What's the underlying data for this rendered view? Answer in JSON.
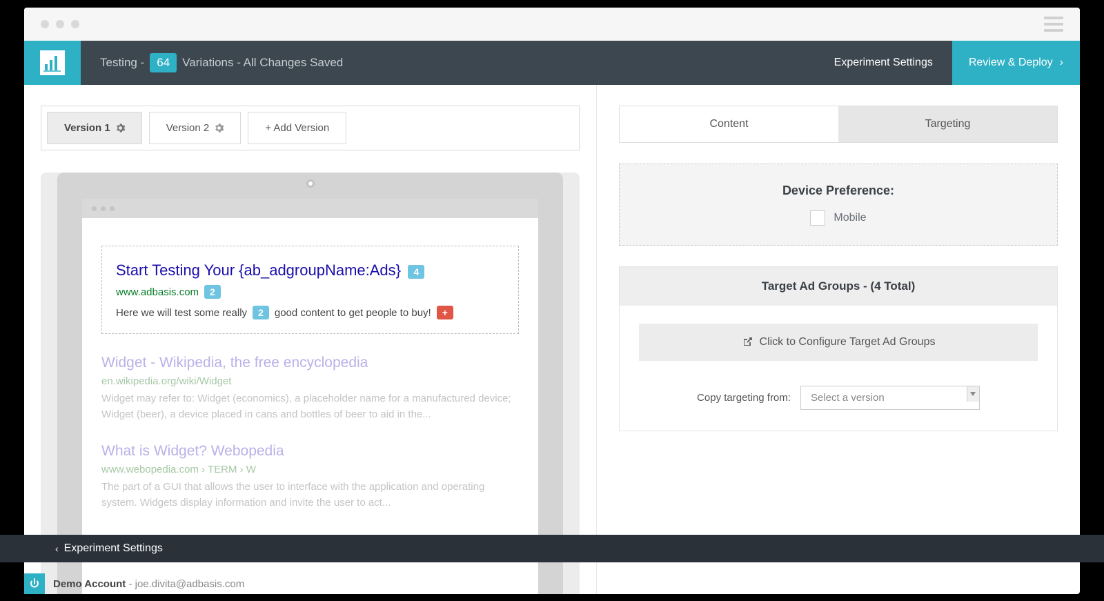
{
  "topbar": {
    "testing_prefix": "Testing -",
    "variation_count": "64",
    "variation_suffix": "Variations - All Changes Saved",
    "experiment_settings": "Experiment Settings",
    "review_deploy": "Review & Deploy"
  },
  "versions": {
    "v1": "Version 1",
    "v2": "Version 2",
    "add": "+ Add Version"
  },
  "serp": {
    "primary": {
      "title": "Start Testing Your {ab_adgroupName:Ads}",
      "title_badge": "4",
      "url": "www.adbasis.com",
      "url_badge": "2",
      "desc_a": "Here we will test some really",
      "desc_badge": "2",
      "desc_b": "good content to get people to buy!",
      "plus": "+"
    },
    "r1": {
      "title": "Widget - Wikipedia, the free encyclopedia",
      "url": "en.wikipedia.org/wiki/Widget",
      "desc": "Widget may refer to: Widget (economics), a placeholder name for a manufactured device; Widget (beer), a device placed in cans and bottles of beer to aid in the..."
    },
    "r2": {
      "title": "What is Widget? Webopedia",
      "url": "www.webopedia.com › TERM › W",
      "desc": "The part of a GUI that allows the user to interface with the application and operating system. Widgets display information and invite the user to act..."
    }
  },
  "panel": {
    "tab_content": "Content",
    "tab_targeting": "Targeting",
    "device_heading": "Device Preference:",
    "device_mobile": "Mobile",
    "target_heading": "Target Ad Groups - (4 Total)",
    "configure": "Click to Configure Target Ad Groups",
    "copy_label": "Copy targeting from:",
    "select_placeholder": "Select a version"
  },
  "bottombar": {
    "label": "Experiment Settings"
  },
  "account": {
    "name": "Demo Account",
    "email": " - joe.divita@adbasis.com"
  }
}
